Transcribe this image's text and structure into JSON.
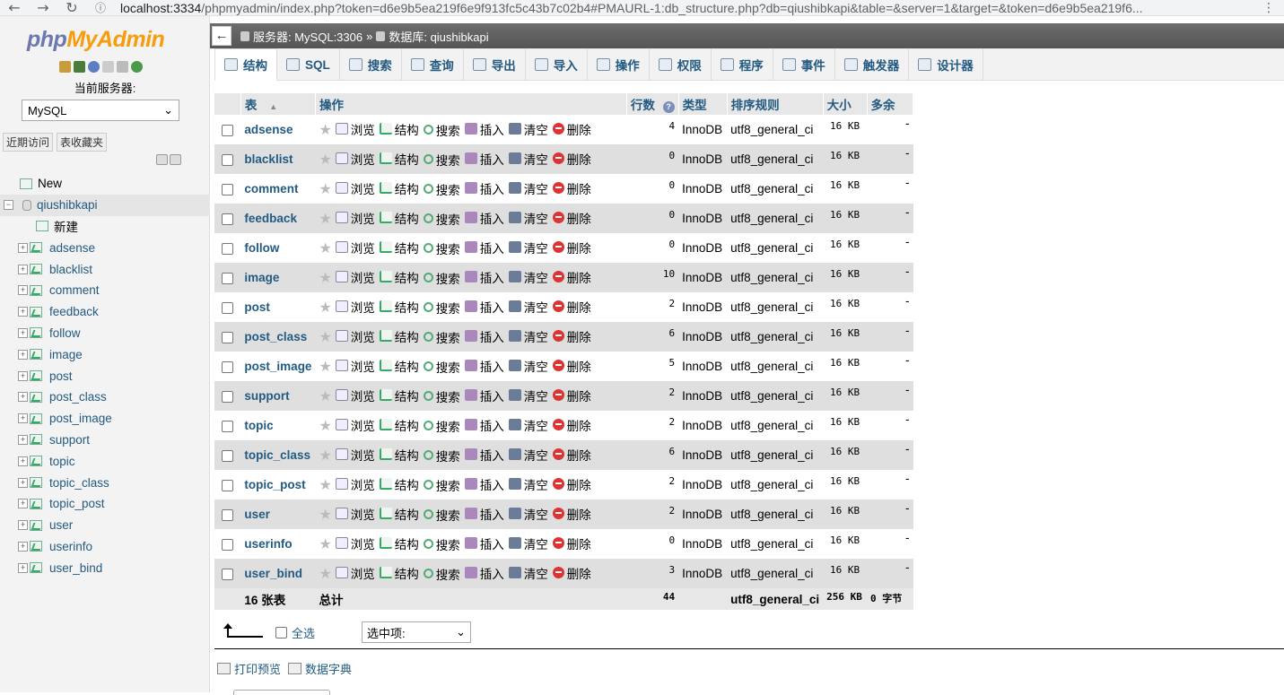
{
  "browser": {
    "url_host": "localhost:3334",
    "url_rest": "/phpmyadmin/index.php?token=d6e9b5ea219f6e9f913fc5c43b7c02b4#PMAURL-1:db_structure.php?db=qiushibkapi&table=&server=1&target=&token=d6e9b5ea219f6..."
  },
  "sidebar": {
    "logo_php": "php",
    "logo_my": "MyAdmin",
    "server_label": "当前服务器:",
    "server_value": "MySQL",
    "tab_recent": "近期访问",
    "tab_favorites": "表收藏夹",
    "new_label": "New",
    "db_name": "qiushibkapi",
    "db_new_label": "新建",
    "tables": [
      "adsense",
      "blacklist",
      "comment",
      "feedback",
      "follow",
      "image",
      "post",
      "post_class",
      "post_image",
      "support",
      "topic",
      "topic_class",
      "topic_post",
      "user",
      "userinfo",
      "user_bind"
    ]
  },
  "breadcrumb": {
    "server": "服务器: MySQL:3306",
    "sep": "»",
    "database": "数据库: qiushibkapi"
  },
  "tabs": [
    "结构",
    "SQL",
    "搜索",
    "查询",
    "导出",
    "导入",
    "操作",
    "权限",
    "程序",
    "事件",
    "触发器",
    "设计器"
  ],
  "table": {
    "headers": {
      "name": "表",
      "sort_arrow": "▲",
      "actions": "操作",
      "rows": "行数",
      "rows_help": "?",
      "type": "类型",
      "collation": "排序规则",
      "size": "大小",
      "overhead": "多余"
    },
    "ops": [
      "浏览",
      "结构",
      "搜索",
      "插入",
      "清空",
      "删除"
    ],
    "rows": [
      {
        "name": "adsense",
        "rows": "4",
        "type": "InnoDB",
        "collation": "utf8_general_ci",
        "size": "16 KB",
        "overhead": "-"
      },
      {
        "name": "blacklist",
        "rows": "0",
        "type": "InnoDB",
        "collation": "utf8_general_ci",
        "size": "16 KB",
        "overhead": "-"
      },
      {
        "name": "comment",
        "rows": "0",
        "type": "InnoDB",
        "collation": "utf8_general_ci",
        "size": "16 KB",
        "overhead": "-"
      },
      {
        "name": "feedback",
        "rows": "0",
        "type": "InnoDB",
        "collation": "utf8_general_ci",
        "size": "16 KB",
        "overhead": "-"
      },
      {
        "name": "follow",
        "rows": "0",
        "type": "InnoDB",
        "collation": "utf8_general_ci",
        "size": "16 KB",
        "overhead": "-"
      },
      {
        "name": "image",
        "rows": "10",
        "type": "InnoDB",
        "collation": "utf8_general_ci",
        "size": "16 KB",
        "overhead": "-"
      },
      {
        "name": "post",
        "rows": "2",
        "type": "InnoDB",
        "collation": "utf8_general_ci",
        "size": "16 KB",
        "overhead": "-"
      },
      {
        "name": "post_class",
        "rows": "6",
        "type": "InnoDB",
        "collation": "utf8_general_ci",
        "size": "16 KB",
        "overhead": "-"
      },
      {
        "name": "post_image",
        "rows": "5",
        "type": "InnoDB",
        "collation": "utf8_general_ci",
        "size": "16 KB",
        "overhead": "-"
      },
      {
        "name": "support",
        "rows": "2",
        "type": "InnoDB",
        "collation": "utf8_general_ci",
        "size": "16 KB",
        "overhead": "-"
      },
      {
        "name": "topic",
        "rows": "2",
        "type": "InnoDB",
        "collation": "utf8_general_ci",
        "size": "16 KB",
        "overhead": "-"
      },
      {
        "name": "topic_class",
        "rows": "6",
        "type": "InnoDB",
        "collation": "utf8_general_ci",
        "size": "16 KB",
        "overhead": "-"
      },
      {
        "name": "topic_post",
        "rows": "2",
        "type": "InnoDB",
        "collation": "utf8_general_ci",
        "size": "16 KB",
        "overhead": "-"
      },
      {
        "name": "user",
        "rows": "2",
        "type": "InnoDB",
        "collation": "utf8_general_ci",
        "size": "16 KB",
        "overhead": "-"
      },
      {
        "name": "userinfo",
        "rows": "0",
        "type": "InnoDB",
        "collation": "utf8_general_ci",
        "size": "16 KB",
        "overhead": "-"
      },
      {
        "name": "user_bind",
        "rows": "3",
        "type": "InnoDB",
        "collation": "utf8_general_ci",
        "size": "16 KB",
        "overhead": "-"
      }
    ],
    "footer": {
      "count": "16 张表",
      "total_label": "总计",
      "rows_total": "44",
      "collation": "utf8_general_ci",
      "size_total": "256 KB",
      "overhead_total": "0 字节"
    }
  },
  "bulk": {
    "check_all": "全选",
    "with_selected": "选中项:"
  },
  "bottom_links": {
    "print": "打印预览",
    "dictionary": "数据字典"
  },
  "colors": {
    "link": "#235a81",
    "row_alt": "#dfdfdf",
    "header_bg": "#e7e7e7",
    "logo_php": "#6c78af",
    "logo_my": "#f89c0e"
  }
}
